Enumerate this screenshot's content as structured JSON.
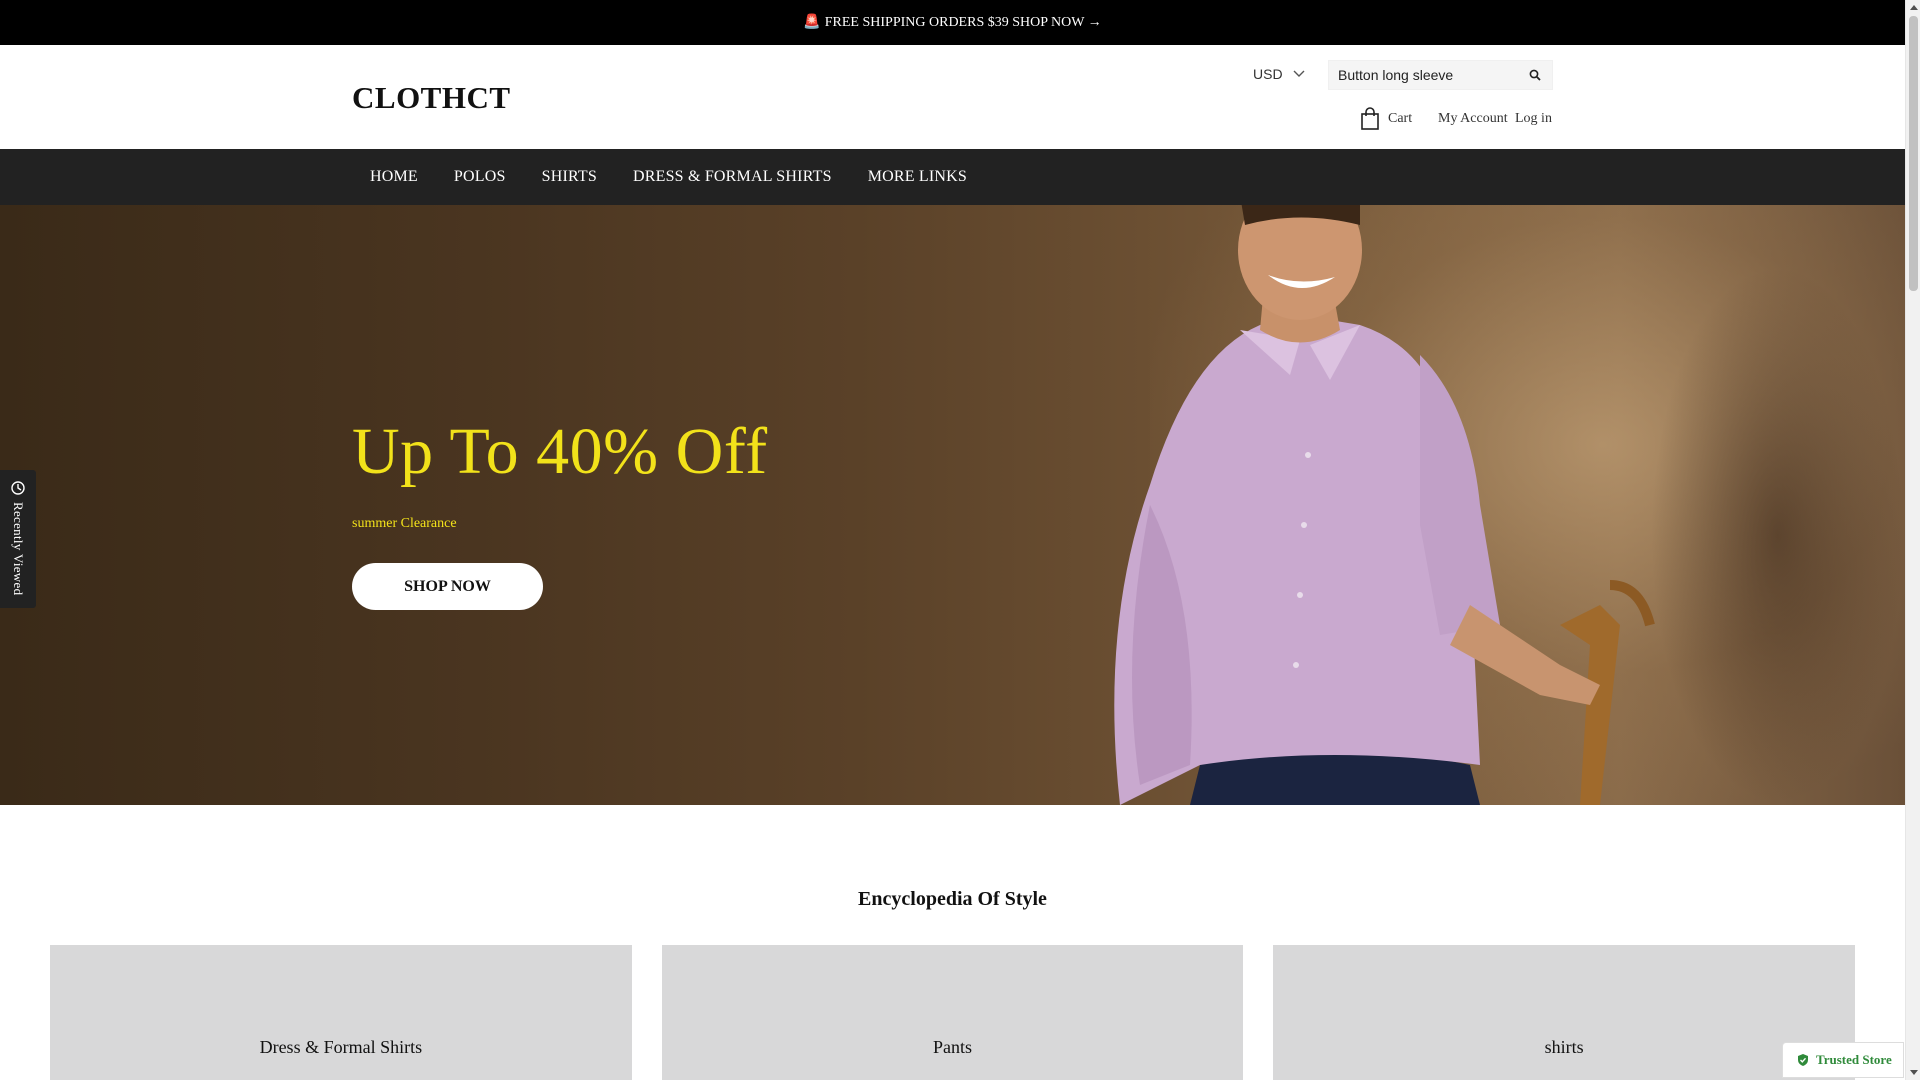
{
  "announcement": {
    "icon": "siren-icon",
    "text": "FREE SHIPPING ORDERS $39 SHOP NOW →"
  },
  "header": {
    "logo": "CLOTHCT",
    "currency": "USD",
    "search": {
      "value": "Button long sleeve",
      "icon": "search-icon"
    },
    "cart_label": "Cart",
    "my_account": "My Account",
    "log_in": "Log in"
  },
  "nav": {
    "items": [
      "HOME",
      "POLOS",
      "SHIRTS",
      "DRESS & FORMAL SHIRTS",
      "MORE LINKS"
    ]
  },
  "hero": {
    "title": "Up To 40% Off",
    "subtitle": "summer Clearance",
    "button": "SHOP NOW",
    "title_color": "#f2e21a"
  },
  "recently_viewed": "Recently Viewed",
  "section": {
    "title": "Encyclopedia Of Style",
    "cards": [
      "Dress & Formal Shirts",
      "Pants",
      "shirts"
    ]
  },
  "trusted_badge": "Trusted Store"
}
